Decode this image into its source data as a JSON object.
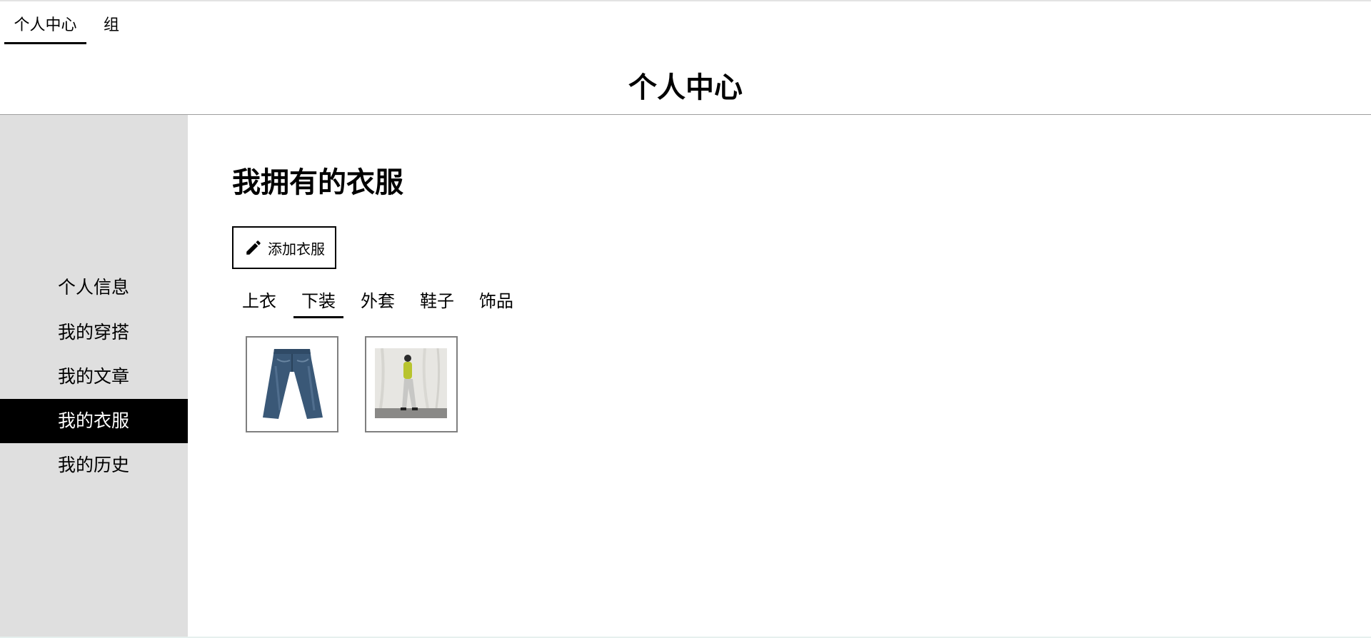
{
  "top_tabs": [
    {
      "label": "个人中心",
      "active": true
    },
    {
      "label": "组",
      "active": false
    }
  ],
  "header": {
    "title": "个人中心"
  },
  "sidebar": {
    "items": [
      {
        "label": "个人信息",
        "active": false
      },
      {
        "label": "我的穿搭",
        "active": false
      },
      {
        "label": "我的文章",
        "active": false
      },
      {
        "label": "我的衣服",
        "active": true
      },
      {
        "label": "我的历史",
        "active": false
      }
    ]
  },
  "main": {
    "section_title": "我拥有的衣服",
    "add_button": {
      "label": "添加衣服",
      "icon": "pencil-icon"
    },
    "categories": [
      {
        "label": "上衣",
        "active": false
      },
      {
        "label": "下装",
        "active": true
      },
      {
        "label": "外套",
        "active": false
      },
      {
        "label": "鞋子",
        "active": false
      },
      {
        "label": "饰品",
        "active": false
      }
    ],
    "items": [
      {
        "image": "jeans-image"
      },
      {
        "image": "outfit-photo-image"
      }
    ]
  },
  "colors": {
    "sidebar_bg": "#dfdfdf",
    "active_bg": "#000000",
    "active_text": "#ffffff",
    "border": "#7f7f7f"
  }
}
